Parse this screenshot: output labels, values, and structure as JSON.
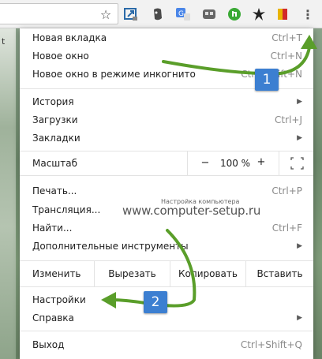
{
  "toolbar": {
    "url_fragment": "t",
    "icons": [
      "star-icon",
      "screenshot-icon",
      "evernote-icon",
      "translate-icon",
      "vpn-icon",
      "green-extension-icon",
      "ninja-icon",
      "flag-icon",
      "menu-icon"
    ]
  },
  "menu": {
    "new_tab": {
      "label": "Новая вкладка",
      "shortcut": "Ctrl+T"
    },
    "new_window": {
      "label": "Новое окно",
      "shortcut": "Ctrl+N"
    },
    "incognito": {
      "label": "Новое окно в режиме инкогнито",
      "shortcut": "Ctrl+Shift+N"
    },
    "history": {
      "label": "История"
    },
    "downloads": {
      "label": "Загрузки",
      "shortcut": "Ctrl+J"
    },
    "bookmarks": {
      "label": "Закладки"
    },
    "zoom": {
      "label": "Масштаб",
      "minus": "−",
      "value": "100 %",
      "plus": "+"
    },
    "print": {
      "label": "Печать...",
      "shortcut": "Ctrl+P"
    },
    "cast": {
      "label": "Трансляция..."
    },
    "find": {
      "label": "Найти...",
      "shortcut": "Ctrl+F"
    },
    "more_tools": {
      "label": "Дополнительные инструменты"
    },
    "edit": {
      "label": "Изменить",
      "cut": "Вырезать",
      "copy": "Копировать",
      "paste": "Вставить"
    },
    "settings": {
      "label": "Настройки"
    },
    "help": {
      "label": "Справка"
    },
    "exit": {
      "label": "Выход",
      "shortcut": "Ctrl+Shift+Q"
    },
    "submenu_arrow": "▶"
  },
  "watermark": {
    "small": "Настройка компьютера",
    "big": "www.computer-setup.ru"
  },
  "annotations": {
    "badge_1": "1",
    "badge_2": "2",
    "color": "#5a9e2a",
    "badge_color": "#3c7fd1"
  }
}
